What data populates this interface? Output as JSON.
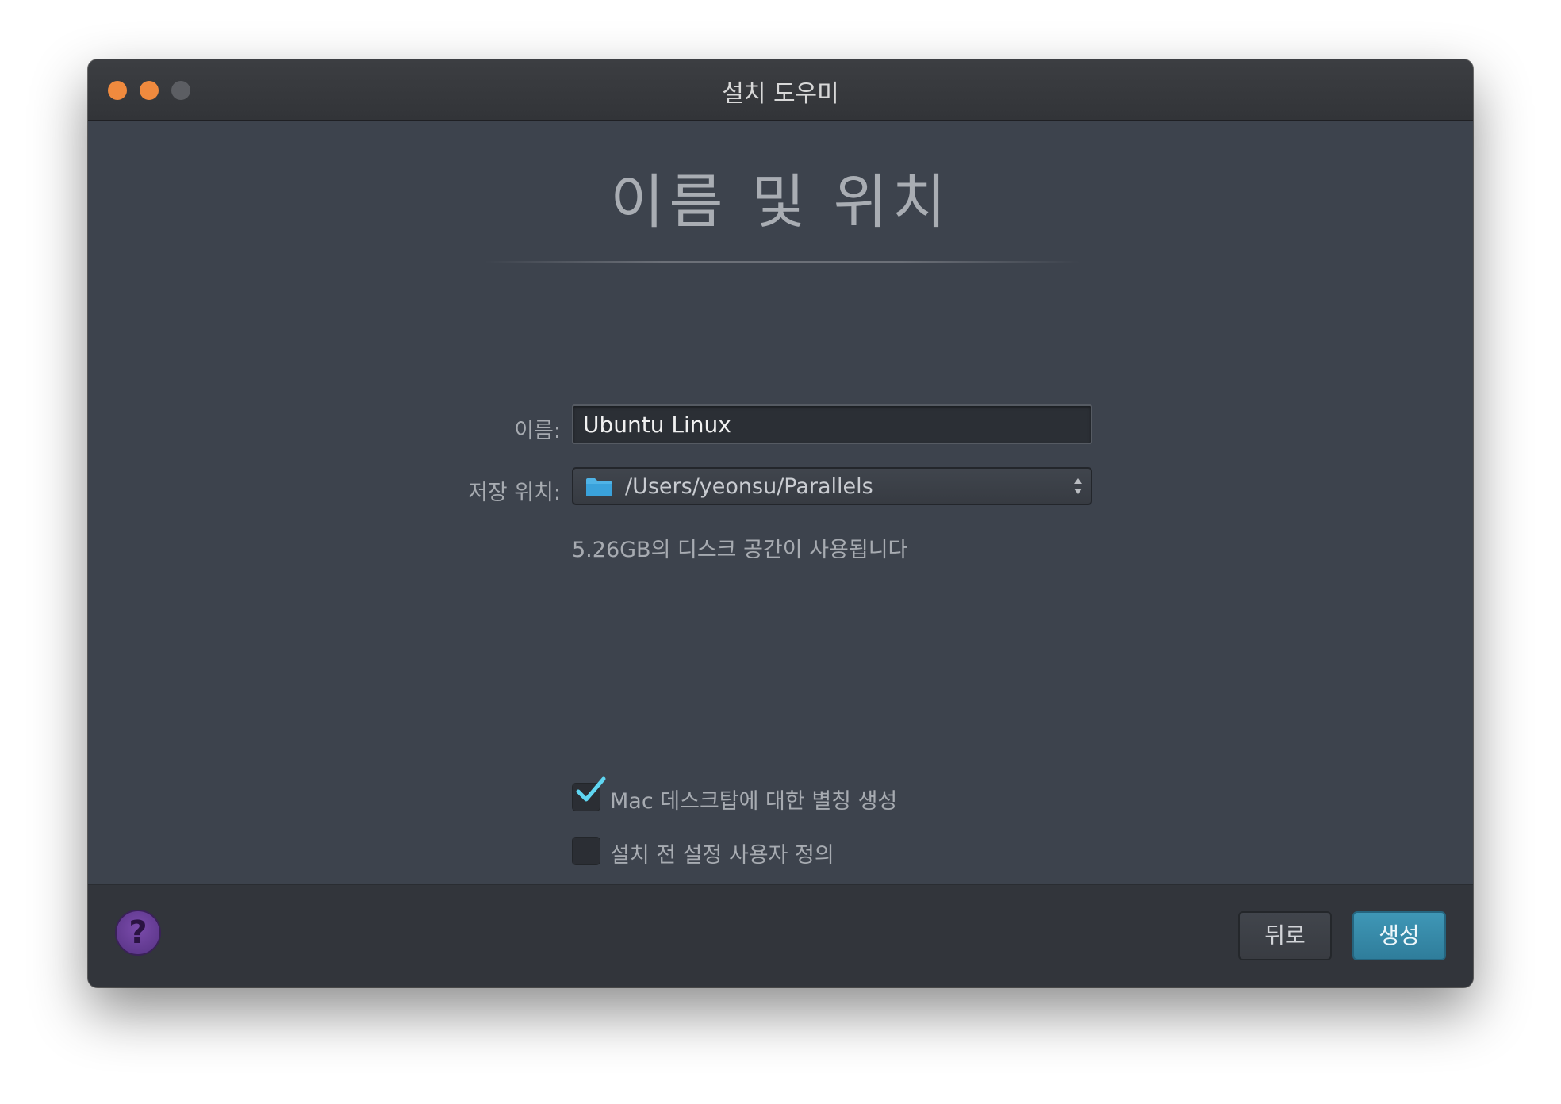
{
  "window": {
    "title": "설치 도우미"
  },
  "page": {
    "heading": "이름 및 위치"
  },
  "form": {
    "name_label": "이름:",
    "name_value": "Ubuntu Linux",
    "location_label": "저장 위치:",
    "location_value": "/Users/yeonsu/Parallels",
    "disk_usage": "5.26GB의 디스크 공간이 사용됩니다"
  },
  "options": [
    {
      "label": "Mac 데스크탑에 대한 별칭 생성",
      "checked": true
    },
    {
      "label": "설치 전 설정 사용자 정의",
      "checked": false
    }
  ],
  "footer": {
    "help_label": "?",
    "back_label": "뒤로",
    "create_label": "생성"
  },
  "colors": {
    "accent": "#3a90b0",
    "close": "#f08a3e",
    "minimize": "#f08a3e",
    "maximize_disabled": "#5c5e63",
    "checkmark": "#5fd6f2",
    "help": "#6a3f9b"
  },
  "icons": {
    "location": "folder-icon",
    "select": "up-down-stepper-icon",
    "checkbox": "checkmark-icon"
  }
}
